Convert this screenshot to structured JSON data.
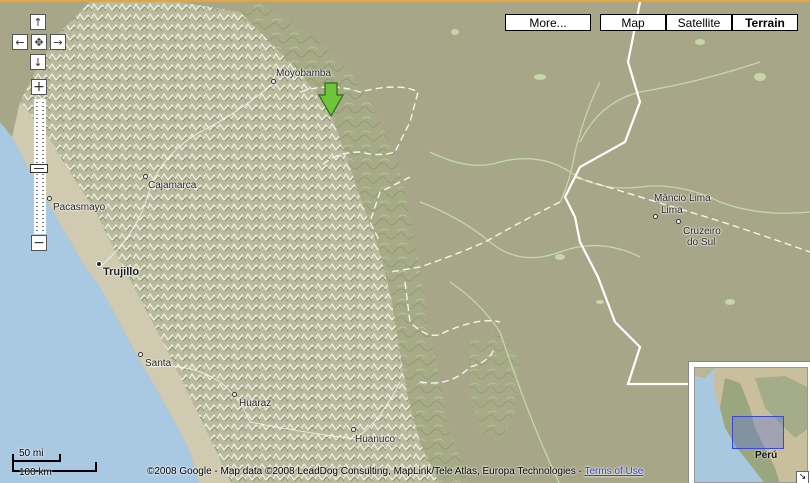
{
  "map_type_buttons": {
    "more": "More...",
    "map": "Map",
    "satellite": "Satellite",
    "terrain": "Terrain",
    "active": "Terrain"
  },
  "controls": {
    "pan_up": "↑",
    "pan_left": "←",
    "pan_center": "✥",
    "pan_right": "→",
    "pan_down": "↓",
    "zoom_in": "+",
    "zoom_out": "−",
    "icons": [
      "arrow-up-icon",
      "arrow-left-icon",
      "center-icon",
      "arrow-right-icon",
      "arrow-down-icon",
      "plus-icon",
      "minus-icon"
    ]
  },
  "places": {
    "moyobamba": "Moyobamba",
    "cajamarca": "Cajamarca",
    "pacasmayo": "Pacasmayo",
    "trujillo": "Trujillo",
    "santa": "Santa",
    "huaraz": "Huaraz",
    "huanuco": "Huanuco",
    "mancio_lima": "Mâncio Lima",
    "cruzeiro_line1": "Cruzeiro",
    "cruzeiro_line2": "do Sul"
  },
  "scale": {
    "miles": "50 mi",
    "km": "100 km"
  },
  "copyright": {
    "text": "©2008 Google - Map data ©2008 LeadDog Consulting, MapLink/Tele Atlas, Europa Technologies - ",
    "terms_link": "Terms of Use"
  },
  "overview": {
    "country_label": "Perú",
    "toggle": "↘"
  },
  "colors": {
    "ocean": "#a9c9e2",
    "lowland": "#a9a688",
    "mountain": "#b5b69a",
    "marker": "#6ec43a",
    "border_accent": "#e8a33a"
  }
}
